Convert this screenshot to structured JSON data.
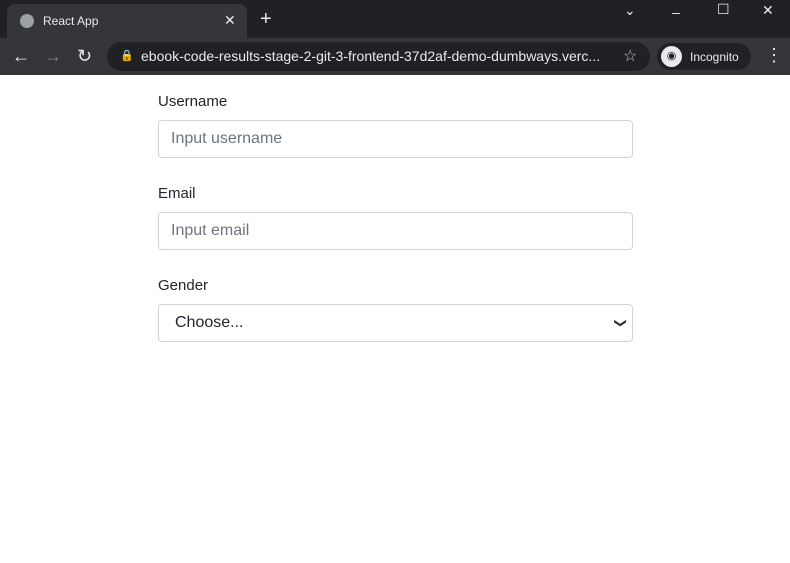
{
  "browser": {
    "tab_title": "React App",
    "url": "ebook-code-results-stage-2-git-3-frontend-37d2af-demo-dumbways.verc...",
    "profile": "Incognito"
  },
  "form": {
    "username_label": "Username",
    "username_placeholder": "Input username",
    "email_label": "Email",
    "email_placeholder": "Input email",
    "gender_label": "Gender",
    "gender_value": "Choose..."
  }
}
